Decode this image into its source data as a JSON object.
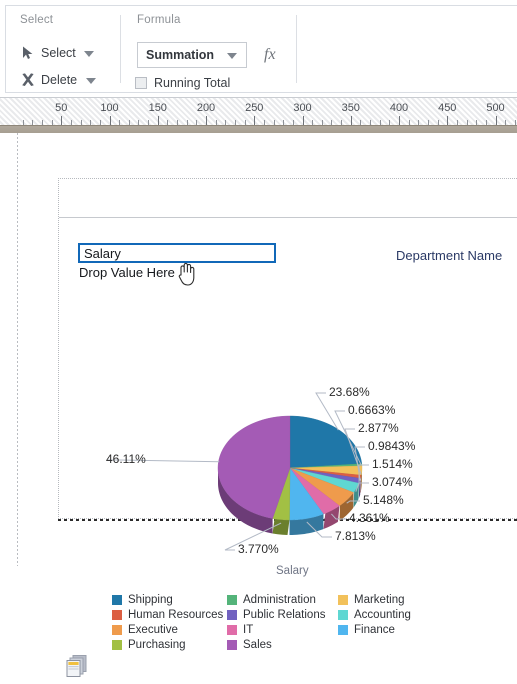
{
  "ribbon": {
    "groups": [
      {
        "title": "Select"
      },
      {
        "title": "Formula"
      }
    ],
    "select_button": {
      "label": "Select",
      "icon": "cursor-arrow-icon"
    },
    "delete_button": {
      "label": "Delete",
      "icon": "x-cross-icon"
    },
    "formula_combo": {
      "value": "Summation",
      "icon": "chevron-down-icon"
    },
    "fx_button": {
      "label": "fx"
    },
    "running_total": {
      "label": "Running Total",
      "checked": false
    }
  },
  "ruler": {
    "unit_marks": [
      50,
      100,
      150,
      200,
      250,
      300,
      350,
      400,
      450,
      500
    ]
  },
  "report": {
    "field_box": {
      "value": "Salary"
    },
    "drop_hint": "Drop Value Here",
    "column_header": "Department Name",
    "pages_icon": "stacked-pages-icon",
    "cursor": "hand-pointer-cursor"
  },
  "chart_data": {
    "type": "pie",
    "title": "",
    "axis_title": "Salary",
    "value_field": "Salary",
    "category_field": "Department Name",
    "legend_position": "bottom",
    "labels_suffix": "%",
    "categories": [
      "Shipping",
      "Administration",
      "Marketing",
      "Human Resources",
      "Public Relations",
      "Accounting",
      "Executive",
      "IT",
      "Finance",
      "Purchasing",
      "Sales"
    ],
    "colors": [
      "#1f77a8",
      "#54b47a",
      "#f2c15b",
      "#dc5f43",
      "#7161c0",
      "#5fd7d2",
      "#ef9b4c",
      "#e06ca8",
      "#50b6ef",
      "#a2c044",
      "#a45bb5"
    ],
    "slices": [
      {
        "name": "Shipping",
        "percent": 23.68,
        "label": "23.68%",
        "color": "#1f77a8"
      },
      {
        "name": "Administration",
        "percent": 0.6663,
        "label": "0.6663%",
        "color": "#54b47a"
      },
      {
        "name": "Marketing",
        "percent": 2.877,
        "label": "2.877%",
        "color": "#f2c15b"
      },
      {
        "name": "Human Resources",
        "percent": 0.9843,
        "label": "0.9843%",
        "color": "#dc5f43"
      },
      {
        "name": "Public Relations",
        "percent": 1.514,
        "label": "1.514%",
        "color": "#7161c0"
      },
      {
        "name": "Accounting",
        "percent": 3.074,
        "label": "3.074%",
        "color": "#5fd7d2"
      },
      {
        "name": "Executive",
        "percent": 5.148,
        "label": "5.148%",
        "color": "#ef9b4c"
      },
      {
        "name": "IT",
        "percent": 4.361,
        "label": "4.361%",
        "color": "#e06ca8"
      },
      {
        "name": "Finance",
        "percent": 7.813,
        "label": "7.813%",
        "color": "#50b6ef"
      },
      {
        "name": "Purchasing",
        "percent": 3.77,
        "label": "3.770%",
        "color": "#a2c044"
      },
      {
        "name": "Sales",
        "percent": 46.11,
        "label": "46.11%",
        "color": "#a45bb5"
      }
    ],
    "legend_columns": [
      [
        "Shipping",
        "Human Resources",
        "Executive",
        "Purchasing"
      ],
      [
        "Administration",
        "Public Relations",
        "IT",
        "Sales"
      ],
      [
        "Marketing",
        "Accounting",
        "Finance"
      ]
    ]
  }
}
